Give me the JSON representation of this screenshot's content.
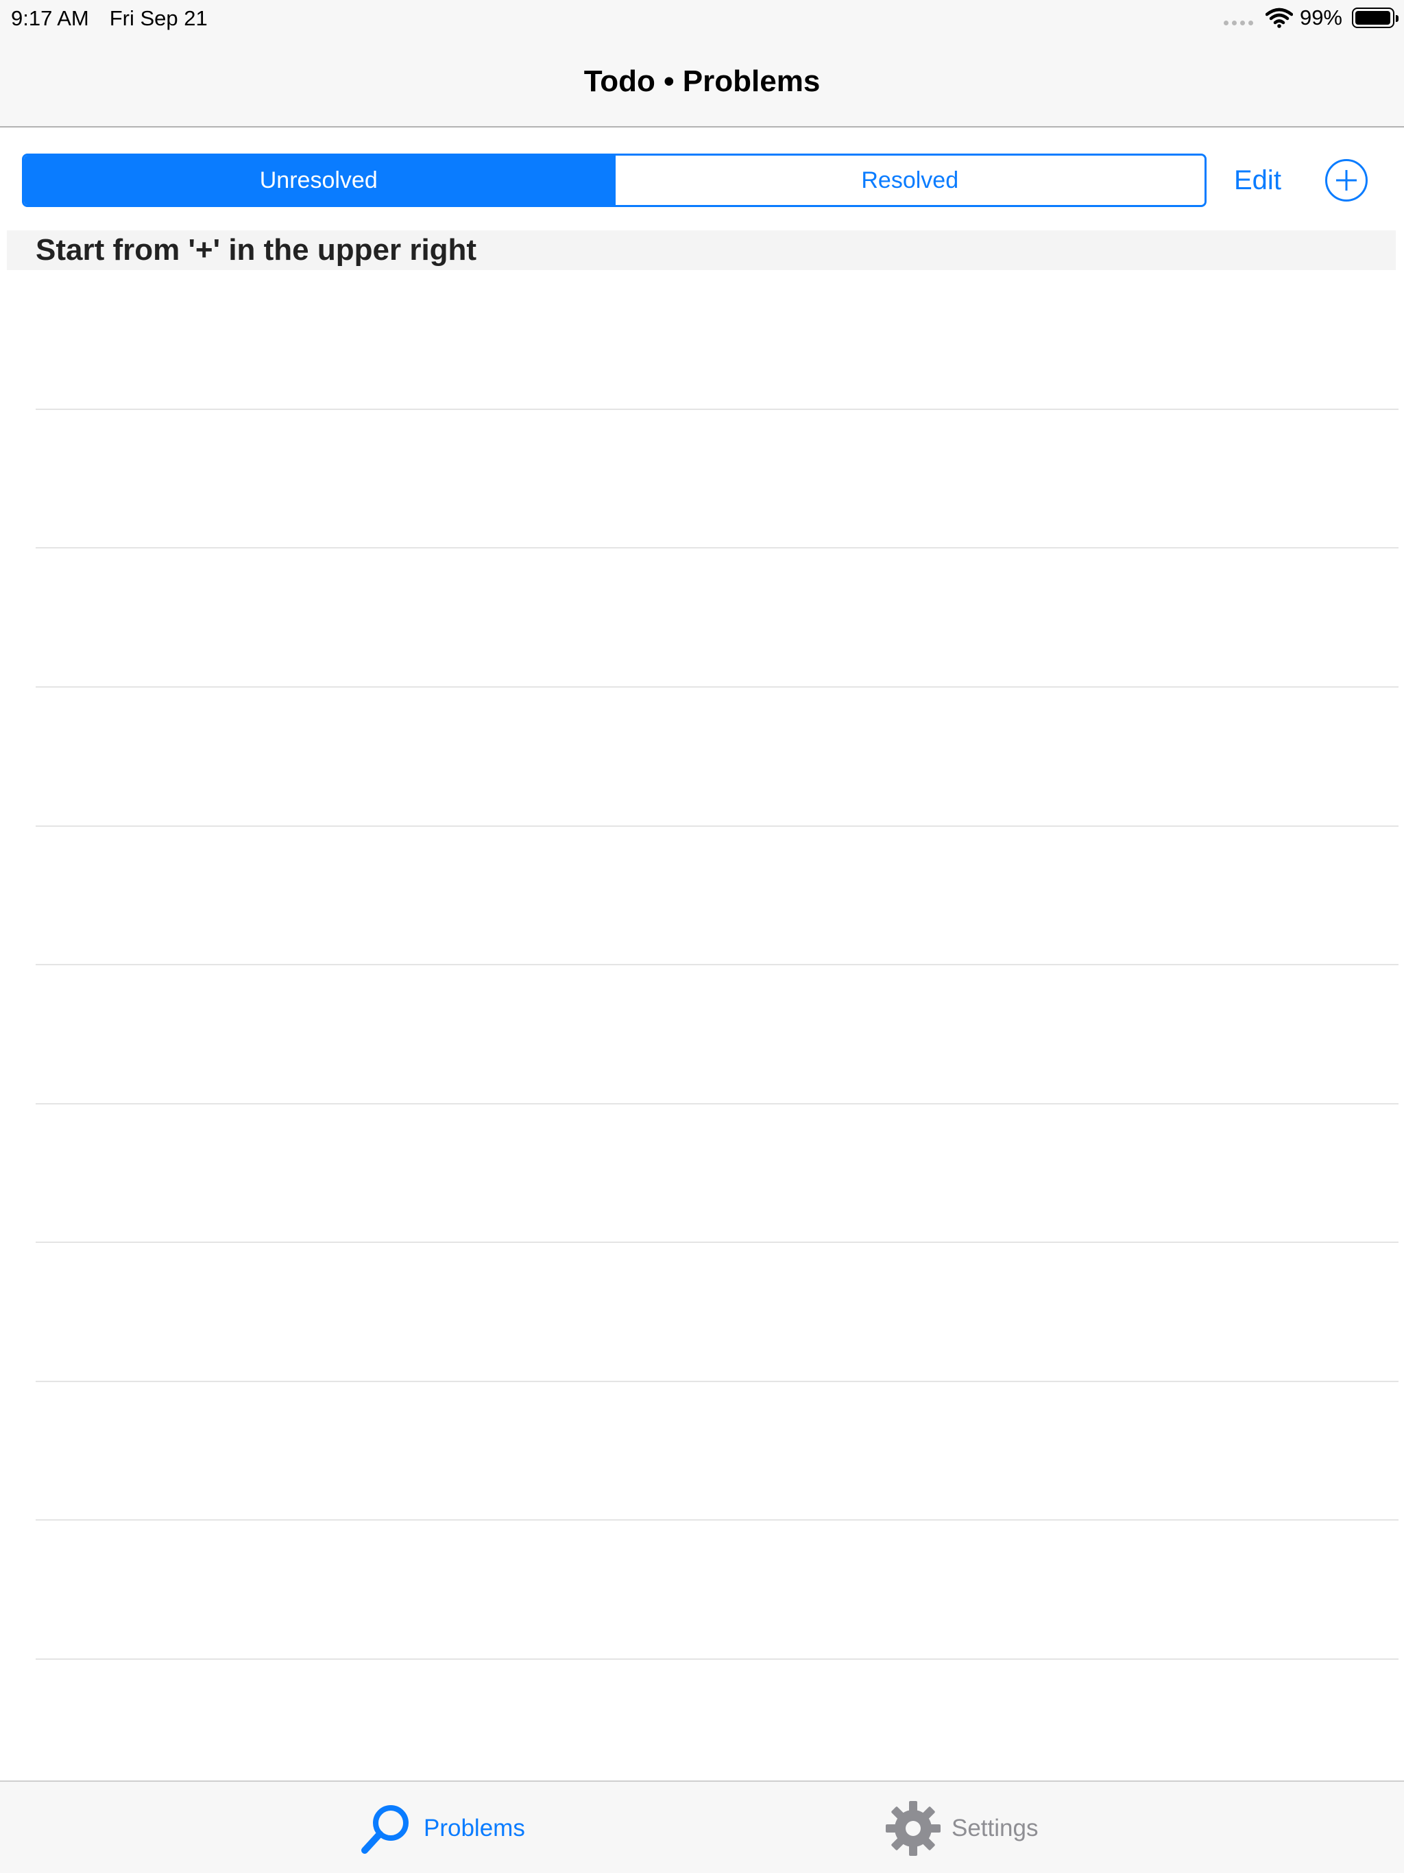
{
  "status_bar": {
    "time": "9:17 AM",
    "date": "Fri Sep 21",
    "battery_text": "99%",
    "battery_level_percent": 99,
    "icons": [
      "signal-dots-icon",
      "wifi-icon",
      "battery-icon"
    ]
  },
  "nav": {
    "title": "Todo • Problems"
  },
  "toolbar": {
    "segments": [
      {
        "label": "Unresolved",
        "selected": true
      },
      {
        "label": "Resolved",
        "selected": false
      }
    ],
    "edit_label": "Edit",
    "add_icon": "plus-circle-icon"
  },
  "list": {
    "section_header": "Start from '+' in the upper right",
    "rows": []
  },
  "tab_bar": {
    "items": [
      {
        "label": "Problems",
        "icon": "magnifier-icon",
        "selected": true
      },
      {
        "label": "Settings",
        "icon": "gear-icon",
        "selected": false
      }
    ]
  },
  "colors": {
    "accent": "#0a7cff",
    "inactive": "#8e8e93",
    "separator": "#e4e4e4",
    "bar_background": "#f7f7f7"
  }
}
